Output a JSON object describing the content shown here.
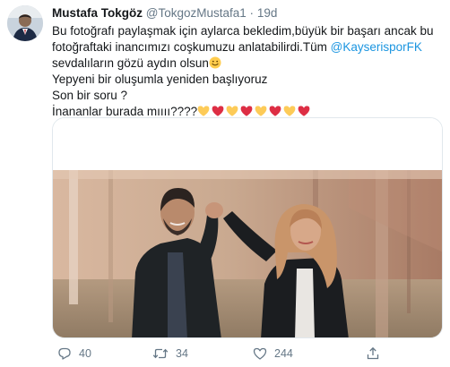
{
  "tweet": {
    "author_name": "Mustafa Tokgöz",
    "handle": "@TokgozMustafa1",
    "separator": "·",
    "time": "19d",
    "text_lines": {
      "l1": "Bu fotoğrafı paylaşmak için aylarca bekledim,büyük bir başarı ancak bu",
      "l2a": "fotoğraftaki inancımızı coşkumuzu anlatabilirdi.Tüm ",
      "mention": "@KayserisporFK",
      "l3": "sevdalıların gözü aydın olsun",
      "l4": "Yepyeni bir oluşumla yeniden başlıyoruz",
      "l5": "Son bir soru ?",
      "l6": "İnananlar burada mıııı????"
    },
    "emojis": {
      "smile": "smiling-face-emoji",
      "hearts": [
        "yellow-heart",
        "red-heart",
        "yellow-heart",
        "red-heart",
        "yellow-heart",
        "red-heart",
        "yellow-heart",
        "red-heart"
      ]
    },
    "colors": {
      "text": "#14171a",
      "secondary": "#657786",
      "link": "#1b95e0",
      "yellow_heart": "#fdcb58",
      "red_heart": "#dd2e44"
    },
    "actions": {
      "replies": "40",
      "retweets": "34",
      "likes": "244"
    }
  }
}
